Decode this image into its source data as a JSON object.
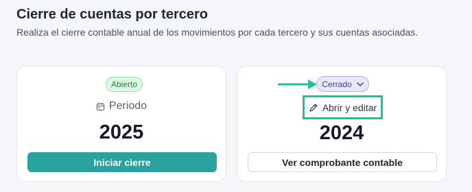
{
  "header": {
    "title": "Cierre de cuentas por tercero",
    "subtitle": "Realiza el cierre contable anual de los movimientos por cada tercero y sus cuentas asociadas."
  },
  "cards": [
    {
      "status": "Abierto",
      "period_label": "Periodo",
      "year": "2025",
      "action_label": "Iniciar cierre",
      "status_color": "#1e8a46"
    },
    {
      "status": "Cerrado",
      "edit_label": "Abrir y editar",
      "year": "2024",
      "action_label": "Ver comprobante contable",
      "status_color": "#3a3f9c"
    }
  ],
  "colors": {
    "primary": "#2aa3a0",
    "highlight": "#1fbfa4"
  },
  "icons": {
    "period": "calendar-icon",
    "dropdown": "chevron-down-icon",
    "edit": "pencil-icon",
    "pointer": "arrow-right-icon"
  }
}
